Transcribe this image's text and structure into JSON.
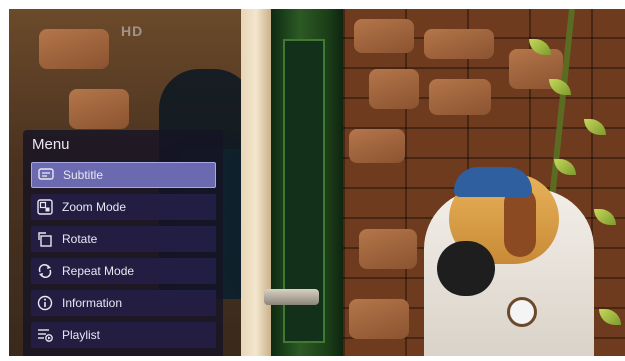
{
  "overlay": {
    "logo_text": "HD"
  },
  "menu": {
    "title": "Menu",
    "items": [
      {
        "label": "Subtitle",
        "icon": "subtitle-icon",
        "selected": true
      },
      {
        "label": "Zoom Mode",
        "icon": "zoom-mode-icon",
        "selected": false
      },
      {
        "label": "Rotate",
        "icon": "rotate-icon",
        "selected": false
      },
      {
        "label": "Repeat Mode",
        "icon": "repeat-icon",
        "selected": false
      },
      {
        "label": "Information",
        "icon": "info-icon",
        "selected": false
      },
      {
        "label": "Playlist",
        "icon": "playlist-icon",
        "selected": false
      }
    ]
  },
  "colors": {
    "menu_bg": "#16142a",
    "item_bg": "#241e48",
    "selected_bg": "#6b6ab0",
    "text": "#e9e7f2"
  }
}
